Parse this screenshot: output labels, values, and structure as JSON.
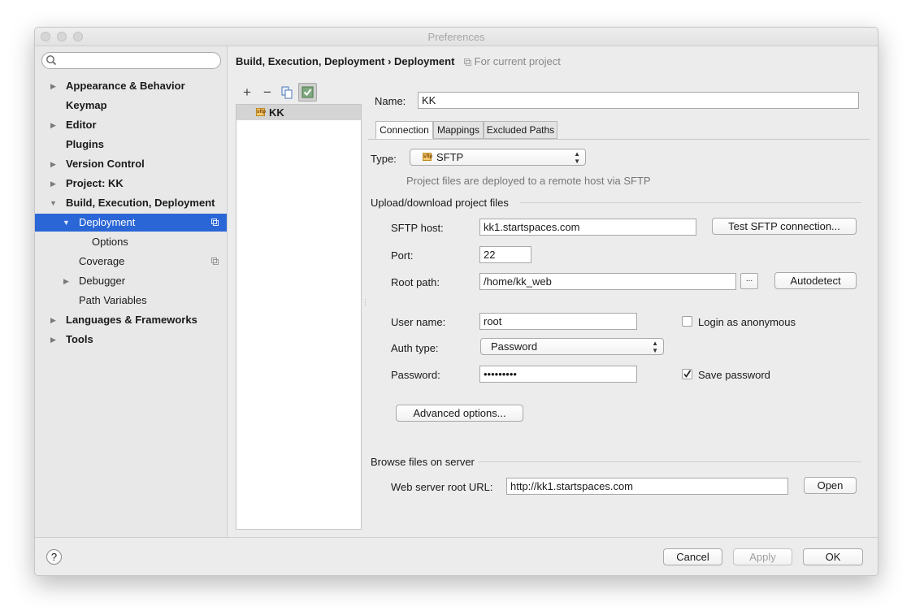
{
  "window": {
    "title": "Preferences"
  },
  "search": {
    "placeholder": ""
  },
  "sidebar": {
    "items": [
      {
        "label": "Appearance & Behavior"
      },
      {
        "label": "Keymap"
      },
      {
        "label": "Editor"
      },
      {
        "label": "Plugins"
      },
      {
        "label": "Version Control"
      },
      {
        "label": "Project: KK"
      },
      {
        "label": "Build, Execution, Deployment"
      },
      {
        "label": "Deployment"
      },
      {
        "label": "Options"
      },
      {
        "label": "Coverage"
      },
      {
        "label": "Debugger"
      },
      {
        "label": "Path Variables"
      },
      {
        "label": "Languages & Frameworks"
      },
      {
        "label": "Tools"
      }
    ]
  },
  "breadcrumb": {
    "path": "Build, Execution, Deployment › Deployment",
    "scope": "For current project"
  },
  "servers": {
    "items": [
      {
        "label": "KK",
        "badge": "sftp"
      }
    ]
  },
  "toolbar": {
    "add": "+",
    "remove": "−"
  },
  "form": {
    "name_label": "Name:",
    "name_value": "KK",
    "tabs": [
      "Connection",
      "Mappings",
      "Excluded Paths"
    ],
    "type_label": "Type:",
    "type_value": "SFTP",
    "type_hint": "Project files are deployed to a remote host via SFTP",
    "upload_section": "Upload/download project files",
    "host_label": "SFTP host:",
    "host_value": "kk1.startspaces.com",
    "test_button": "Test SFTP connection...",
    "port_label": "Port:",
    "port_value": "22",
    "root_label": "Root path:",
    "root_value": "/home/kk_web",
    "browse_button": "...",
    "autodetect_button": "Autodetect",
    "user_label": "User name:",
    "user_value": "root",
    "anon_label": "Login as anonymous",
    "anon_checked": false,
    "auth_label": "Auth type:",
    "auth_value": "Password",
    "password_label": "Password:",
    "password_value": "•••••••••",
    "save_pw_label": "Save password",
    "save_pw_checked": true,
    "advanced_button": "Advanced options...",
    "browse_section": "Browse files on server",
    "web_label": "Web server root URL:",
    "web_value": "http://kk1.startspaces.com",
    "open_button": "Open"
  },
  "footer": {
    "help": "?",
    "cancel": "Cancel",
    "apply": "Apply",
    "ok": "OK"
  },
  "colors": {
    "selection": "#2a66d6",
    "window_bg": "#ececec"
  }
}
